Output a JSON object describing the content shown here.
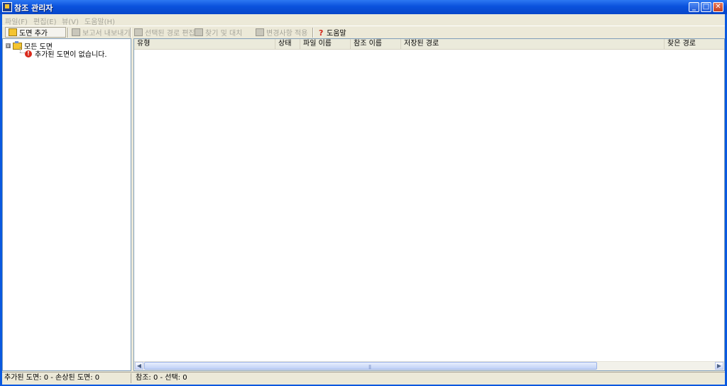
{
  "window": {
    "title": "참조 관리자",
    "min": "_",
    "max": "□",
    "close": "✕",
    "icon": "app-icon"
  },
  "menu": [
    "파일(F)",
    "편집(E)",
    "뷰(V)",
    "도움말(H)"
  ],
  "toolbar": {
    "add_drawing": "도면 추가",
    "export_report": "보고서 내보내기",
    "edit_path": "선택된 경로 편집",
    "find_replace": "찾기 및 대치",
    "apply_changes": "변경사항 적용",
    "help": "도움말"
  },
  "tree": {
    "root": "모든 도면",
    "expander": "⊟",
    "child": "추가된 도면이 없습니다."
  },
  "table": {
    "columns": [
      "유형",
      "상태",
      "파일 이름",
      "참조 이름",
      "저장된 경로",
      "찾은 경로"
    ],
    "rows": []
  },
  "status": {
    "left": "추가된 도면: 0  -  손상된 도면: 0",
    "right": "참조: 0  -  선택: 0"
  },
  "colors": {
    "titlebar": "#0A52DD",
    "disabled_text": "#A7A69B",
    "error": "#D92A1C"
  }
}
